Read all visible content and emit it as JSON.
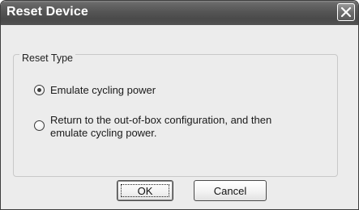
{
  "window": {
    "title": "Reset Device"
  },
  "icons": {
    "close": "close-icon"
  },
  "group": {
    "label": "Reset Type",
    "options": [
      {
        "label": "Emulate cycling power",
        "selected": true
      },
      {
        "label": "Return to the out-of-box configuration, and then\nemulate cycling power.",
        "selected": false
      }
    ]
  },
  "buttons": {
    "ok_label": "OK",
    "cancel_label": "Cancel"
  },
  "colors": {
    "titlebar": "#555555",
    "dialog_bg": "#ececec"
  }
}
